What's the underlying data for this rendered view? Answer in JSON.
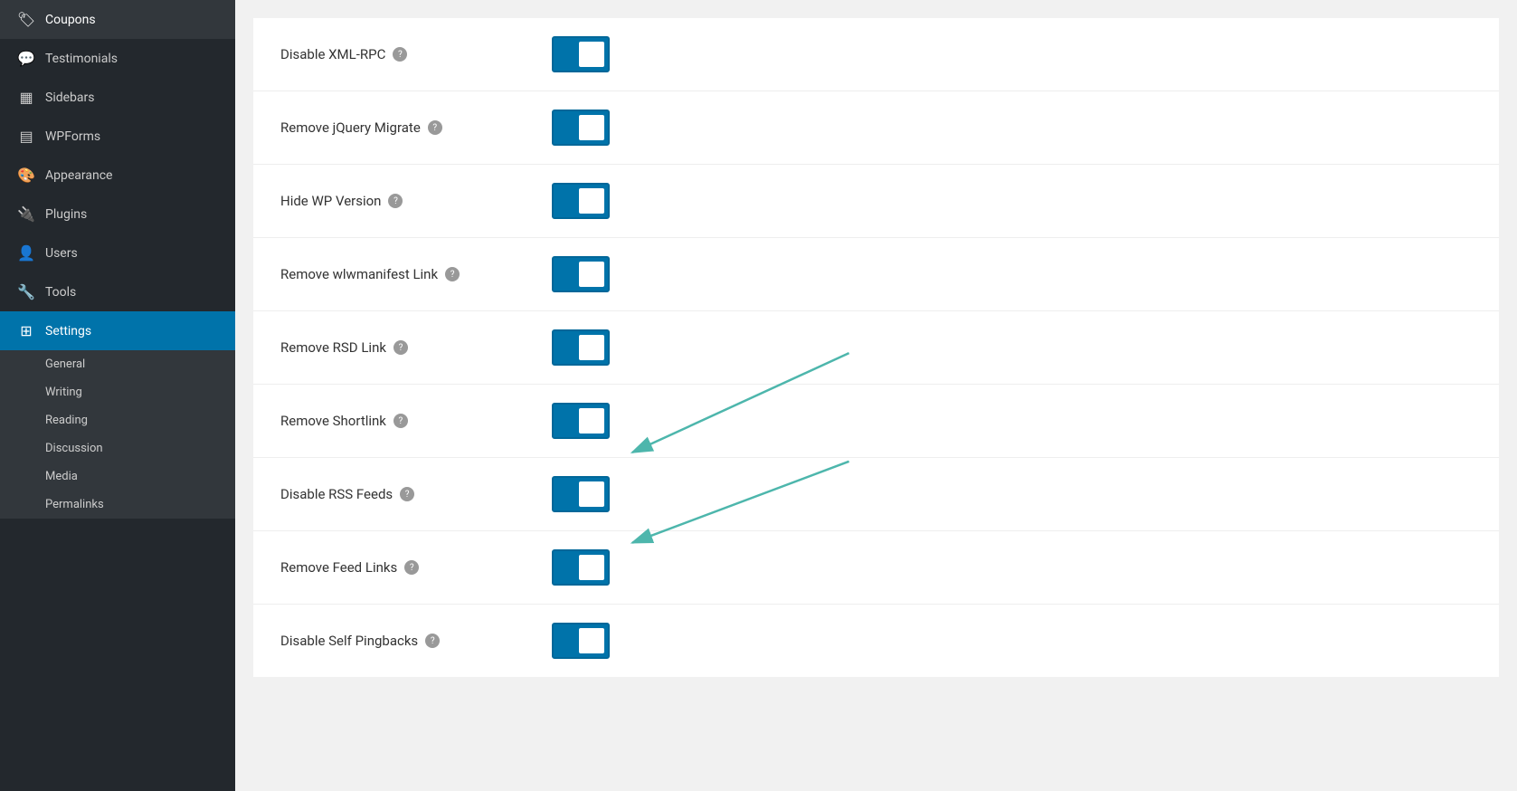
{
  "sidebar": {
    "items": [
      {
        "id": "coupons",
        "label": "Coupons",
        "icon": "🏷"
      },
      {
        "id": "testimonials",
        "label": "Testimonials",
        "icon": "💬"
      },
      {
        "id": "sidebars",
        "label": "Sidebars",
        "icon": "▦"
      },
      {
        "id": "wpforms",
        "label": "WPForms",
        "icon": "▤"
      },
      {
        "id": "appearance",
        "label": "Appearance",
        "icon": "🎨"
      },
      {
        "id": "plugins",
        "label": "Plugins",
        "icon": "🔌"
      },
      {
        "id": "users",
        "label": "Users",
        "icon": "👤"
      },
      {
        "id": "tools",
        "label": "Tools",
        "icon": "🔧"
      },
      {
        "id": "settings",
        "label": "Settings",
        "icon": "⊞",
        "active": true
      }
    ],
    "sub_items": [
      {
        "id": "general",
        "label": "General"
      },
      {
        "id": "writing",
        "label": "Writing"
      },
      {
        "id": "reading",
        "label": "Reading"
      },
      {
        "id": "discussion",
        "label": "Discussion"
      },
      {
        "id": "media",
        "label": "Media"
      },
      {
        "id": "permalinks",
        "label": "Permalinks"
      }
    ]
  },
  "settings_rows": [
    {
      "id": "disable-xml-rpc",
      "label": "Disable XML-RPC",
      "enabled": true
    },
    {
      "id": "remove-jquery-migrate",
      "label": "Remove jQuery Migrate",
      "enabled": true
    },
    {
      "id": "hide-wp-version",
      "label": "Hide WP Version",
      "enabled": true
    },
    {
      "id": "remove-wlwmanifest-link",
      "label": "Remove wlwmanifest Link",
      "enabled": true
    },
    {
      "id": "remove-rsd-link",
      "label": "Remove RSD Link",
      "enabled": true
    },
    {
      "id": "remove-shortlink",
      "label": "Remove Shortlink",
      "enabled": true
    },
    {
      "id": "disable-rss-feeds",
      "label": "Disable RSS Feeds",
      "enabled": true
    },
    {
      "id": "remove-feed-links",
      "label": "Remove Feed Links",
      "enabled": true
    },
    {
      "id": "disable-self-pingbacks",
      "label": "Disable Self Pingbacks",
      "enabled": true
    }
  ],
  "colors": {
    "sidebar_bg": "#23282d",
    "sidebar_active": "#0073aa",
    "toggle_on": "#0073aa",
    "toggle_off": "#aaaaaa",
    "arrow_color": "#4db6ac"
  }
}
